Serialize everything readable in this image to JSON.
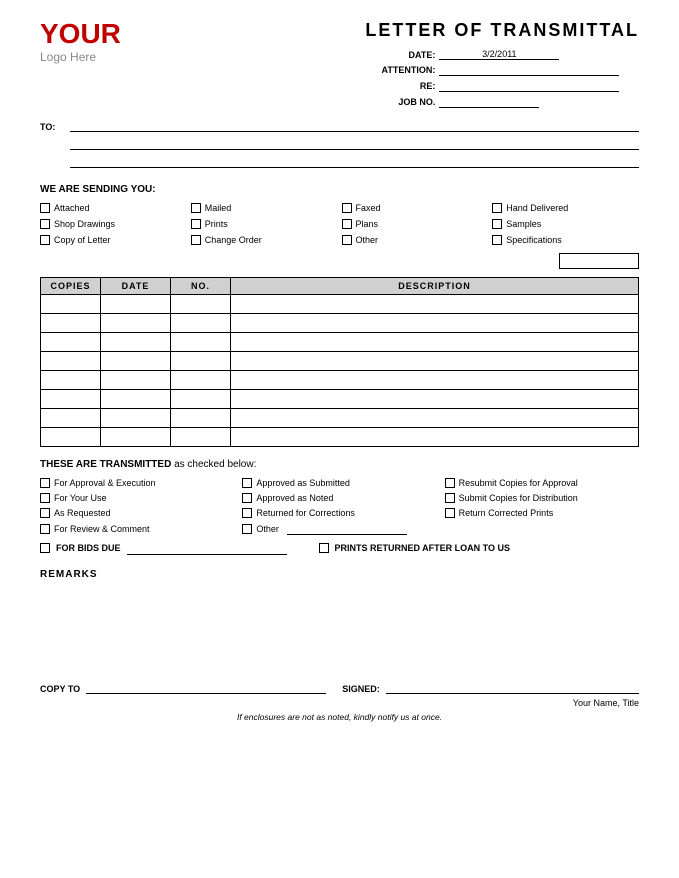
{
  "header": {
    "logo_your": "YOUR",
    "logo_sub": "Logo Here",
    "title": "LETTER OF TRANSMITTAL"
  },
  "meta": {
    "date_label": "DATE:",
    "date_value": "3/2/2011",
    "attention_label": "ATTENTION:",
    "re_label": "RE:",
    "job_no_label": "JOB NO."
  },
  "to_label": "TO:",
  "we_are_sending": "WE ARE SENDING YOU:",
  "checkboxes": [
    {
      "label": "Attached"
    },
    {
      "label": "Mailed"
    },
    {
      "label": "Faxed"
    },
    {
      "label": "Hand Delivered"
    },
    {
      "label": "Shop Drawings"
    },
    {
      "label": "Prints"
    },
    {
      "label": "Plans"
    },
    {
      "label": "Samples"
    },
    {
      "label": "Copy of Letter"
    },
    {
      "label": "Change Order"
    },
    {
      "label": "Other"
    },
    {
      "label": "Specifications"
    }
  ],
  "table": {
    "headers": [
      "COPIES",
      "DATE",
      "NO.",
      "DESCRIPTION"
    ],
    "rows": 8
  },
  "transmitted_title_1": "THESE ARE TRANSMITTED",
  "transmitted_title_2": "as checked below:",
  "transmitted_items": [
    {
      "label": "For Approval & Execution"
    },
    {
      "label": "Approved as Submitted"
    },
    {
      "label": "Resubmit Copies for Approval"
    },
    {
      "label": "For Your Use"
    },
    {
      "label": "Approved as Noted"
    },
    {
      "label": "Submit Copies for Distribution"
    },
    {
      "label": "As Requested"
    },
    {
      "label": "Returned for Corrections"
    },
    {
      "label": "Return Corrected Prints"
    },
    {
      "label": "For Review & Comment"
    },
    {
      "label": "Other"
    },
    {
      "label": ""
    }
  ],
  "bids_label": "FOR BIDS DUE",
  "prints_label": "PRINTS RETURNED AFTER LOAN TO US",
  "remarks_label": "REMARKS",
  "copy_to_label": "COPY TO",
  "signed_label": "SIGNED:",
  "name_title": "Your Name, Title",
  "footer_note": "If enclosures are not as noted, kindly notify us at once."
}
